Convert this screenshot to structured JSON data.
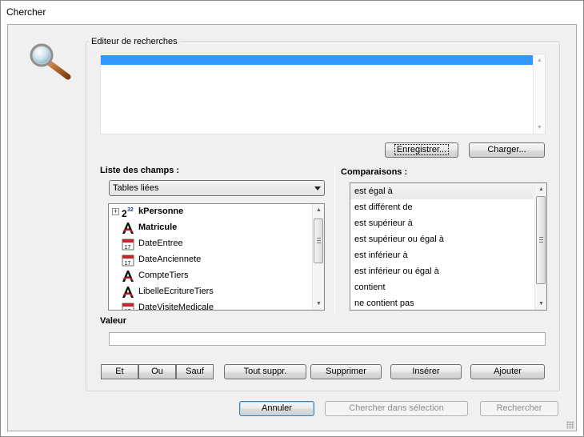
{
  "window": {
    "title": "Chercher"
  },
  "editor": {
    "group_label": "Editeur de recherches",
    "save_label": "Enregistrer...",
    "load_label": "Charger..."
  },
  "fields": {
    "label": "Liste des champs :",
    "dropdown_value": "Tables liées",
    "items": [
      {
        "label": "kPersonne",
        "icon": "integer-32-icon",
        "bold": true,
        "expandable": true
      },
      {
        "label": "Matricule",
        "icon": "text-field-icon",
        "bold": true,
        "expandable": false
      },
      {
        "label": "DateEntree",
        "icon": "calendar-icon",
        "bold": false,
        "expandable": false
      },
      {
        "label": "DateAnciennete",
        "icon": "calendar-icon",
        "bold": false,
        "expandable": false
      },
      {
        "label": "CompteTiers",
        "icon": "text-field-icon",
        "bold": false,
        "expandable": false
      },
      {
        "label": "LibelleEcritureTiers",
        "icon": "text-field-icon",
        "bold": false,
        "expandable": false
      },
      {
        "label": "DateVisiteMedicale",
        "icon": "calendar-icon",
        "bold": false,
        "expandable": false
      }
    ]
  },
  "comparisons": {
    "label": "Comparaisons :",
    "items": [
      "est égal à",
      "est différent de",
      "est supérieur à",
      "est supérieur ou égal à",
      "est inférieur à",
      "est inférieur ou égal à",
      "contient",
      "ne contient pas"
    ],
    "selected_index": 0
  },
  "value": {
    "label": "Valeur",
    "current": ""
  },
  "operators": {
    "and": "Et",
    "or": "Ou",
    "except": "Sauf"
  },
  "actions": {
    "clear_all": "Tout suppr.",
    "delete": "Supprimer",
    "insert": "Insérer",
    "add": "Ajouter"
  },
  "footer": {
    "cancel": "Annuler",
    "search_selection": "Chercher dans sélection",
    "search": "Rechercher"
  },
  "colors": {
    "selection": "#3399ff",
    "client_bg": "#f0f0f0"
  }
}
